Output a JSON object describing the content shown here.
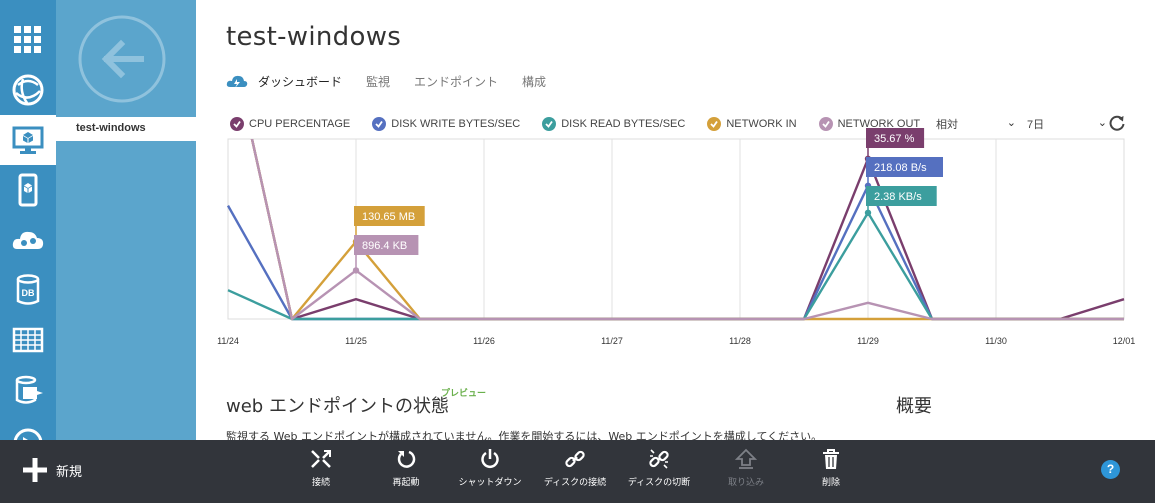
{
  "sidebar": {
    "items": [
      {
        "icon": "all-items-grid-icon"
      },
      {
        "icon": "web-sites-globe-icon"
      },
      {
        "icon": "virtual-machines-monitor-icon",
        "active": true
      },
      {
        "icon": "mobile-services-phone-icon"
      },
      {
        "icon": "cloud-services-gears-icon"
      },
      {
        "icon": "sql-databases-db-icon"
      },
      {
        "icon": "storage-table-icon"
      },
      {
        "icon": "hdinsight-elephant-icon"
      },
      {
        "icon": "media-services-icon"
      }
    ],
    "sub_item_label": "test-windows"
  },
  "header": {
    "title": "test-windows",
    "tabs": [
      {
        "label": "ダッシュボード",
        "active": true
      },
      {
        "label": "監視"
      },
      {
        "label": "エンドポイント"
      },
      {
        "label": "構成"
      }
    ]
  },
  "chart_controls": {
    "range_value": "相対",
    "period_value": "7日"
  },
  "chart_data": {
    "type": "line",
    "x": [
      "11/24",
      "11/24 12h",
      "11/25",
      "11/25 12h",
      "11/26",
      "11/26 12h",
      "11/27",
      "11/27 12h",
      "11/28",
      "11/28 12h",
      "11/29",
      "11/29 12h",
      "11/30",
      "11/30 12h",
      "12/01"
    ],
    "x_tick_labels": [
      "11/24",
      "11/25",
      "11/26",
      "11/27",
      "11/28",
      "11/29",
      "11/30",
      "12/01"
    ],
    "ylim": [
      0,
      100
    ],
    "grid": true,
    "series": [
      {
        "name": "CPU PERCENTAGE",
        "color": "#7a3e6d",
        "values": [
          160,
          0,
          11,
          0,
          0,
          0,
          0,
          0,
          0,
          0,
          89,
          0,
          0,
          0,
          11
        ]
      },
      {
        "name": "DISK WRITE BYTES/SEC",
        "color": "#5570c0",
        "values": [
          63,
          0,
          0,
          0,
          0,
          0,
          0,
          0,
          0,
          0,
          74,
          0,
          0,
          0,
          0
        ]
      },
      {
        "name": "DISK READ BYTES/SEC",
        "color": "#3c9e9e",
        "values": [
          16,
          0,
          0,
          0,
          0,
          0,
          0,
          0,
          0,
          0,
          59,
          0,
          0,
          0,
          0
        ]
      },
      {
        "name": "NETWORK IN",
        "color": "#d4a03a",
        "values": [
          160,
          0,
          43,
          0,
          0,
          0,
          0,
          0,
          0,
          0,
          0,
          0,
          0,
          0,
          0
        ]
      },
      {
        "name": "NETWORK OUT",
        "color": "#b793b3",
        "values": [
          160,
          0,
          27,
          0,
          0,
          0,
          0,
          0,
          0,
          0,
          9,
          0,
          0,
          0,
          0
        ]
      }
    ],
    "annotations": [
      {
        "text": "130.65 MB",
        "series": 3,
        "point": 2
      },
      {
        "text": "896.4 KB",
        "series": 4,
        "point": 2
      },
      {
        "text": "35.67 %",
        "series": 0,
        "point": 10
      },
      {
        "text": "218.08 B/s",
        "series": 1,
        "point": 10
      },
      {
        "text": "2.38 KB/s",
        "series": 2,
        "point": 10
      }
    ]
  },
  "endpoint_section": {
    "title": "web エンドポイントの状態",
    "preview_badge": "プレビュー",
    "message": "監視する Web エンドポイントが構成されていません。作業を開始するには、Web エンドポイントを構成してください。"
  },
  "overview": {
    "title": "概要"
  },
  "commands": {
    "new_label": "新規",
    "items": [
      {
        "label": "接続",
        "icon": "connect-icon"
      },
      {
        "label": "再起動",
        "icon": "restart-icon"
      },
      {
        "label": "シャットダウン",
        "icon": "shutdown-icon"
      },
      {
        "label": "ディスクの接続",
        "icon": "attach-disk-link-icon"
      },
      {
        "label": "ディスクの切断",
        "icon": "detach-disk-broken-link-icon"
      },
      {
        "label": "取り込み",
        "icon": "capture-icon",
        "disabled": true
      },
      {
        "label": "削除",
        "icon": "delete-trash-icon"
      }
    ],
    "help_label": "?"
  }
}
